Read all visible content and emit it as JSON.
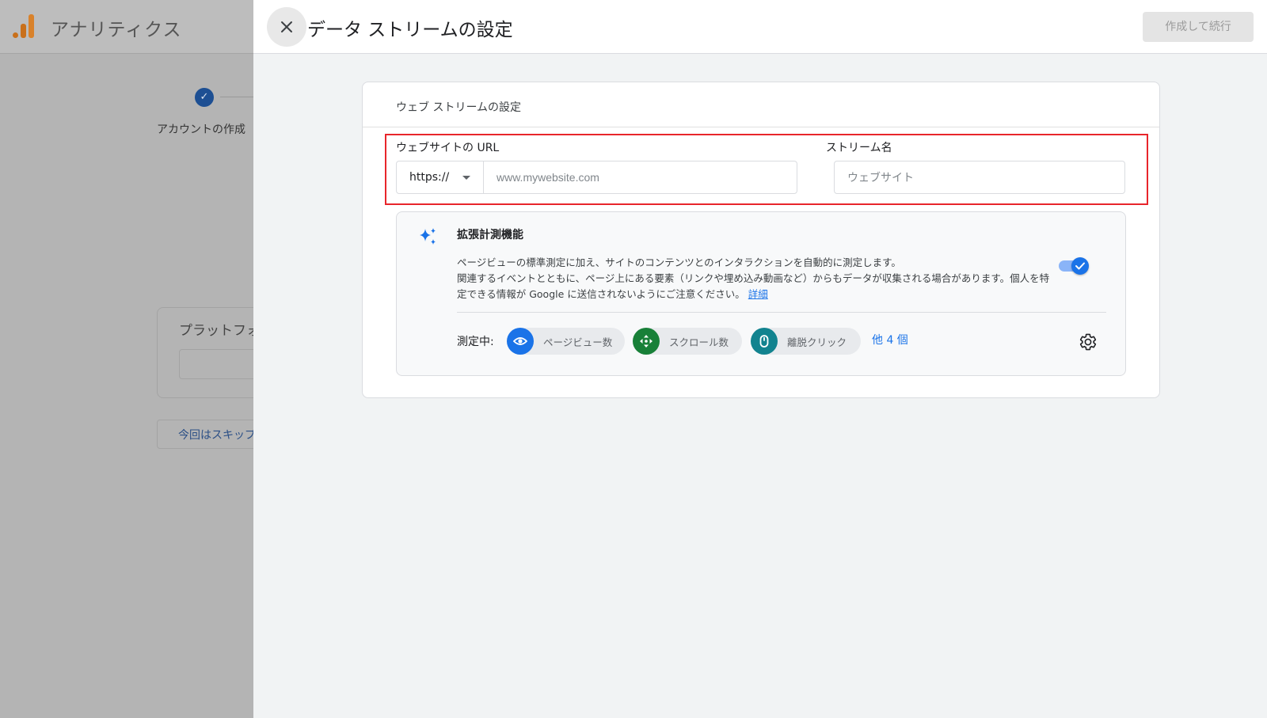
{
  "background": {
    "app_title": "アナリティクス",
    "step_label": "アカウントの作成",
    "platform_label": "プラットフォ",
    "skip_label": "今回はスキップ"
  },
  "panel": {
    "title": "データ ストリームの設定",
    "create_button": "作成して続行",
    "card_title": "ウェブ ストリームの設定",
    "url_field": {
      "label": "ウェブサイトの URL",
      "protocol": "https://",
      "placeholder": "www.mywebsite.com",
      "value": ""
    },
    "stream_field": {
      "label": "ストリーム名",
      "placeholder": "ウェブサイト",
      "value": ""
    },
    "enhanced": {
      "title": "拡張計測機能",
      "description_1": "ページビューの標準測定に加え、サイトのコンテンツとのインタラクションを自動的に測定します。",
      "description_2": "関連するイベントとともに、ページ上にある要素（リンクや埋め込み動画など）からもデータが収集される場合があります。個人を特定できる情報が Google に送信されないようにご注意ください。",
      "details_link": "詳細",
      "toggle_on": true,
      "measuring_label": "測定中:",
      "chips": [
        {
          "label": "ページビュー数",
          "icon": "eye-icon",
          "color": "#1a73e8"
        },
        {
          "label": "スクロール数",
          "icon": "scroll-icon",
          "color": "#188038"
        },
        {
          "label": "離脱クリック",
          "icon": "mouse-icon",
          "color": "#12838f"
        }
      ],
      "more_link": "他 4 個"
    }
  },
  "colors": {
    "accent": "#1a73e8",
    "highlight": "#e8252b",
    "overlay": "#b4b4b4"
  }
}
